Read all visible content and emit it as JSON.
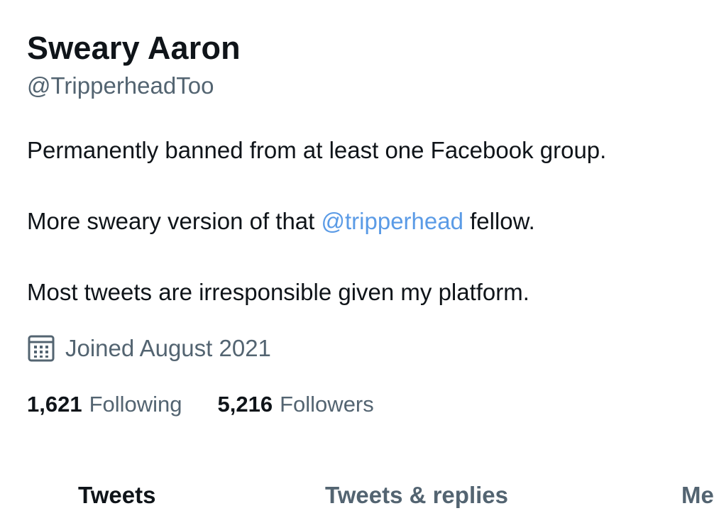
{
  "profile": {
    "display_name": "Sweary Aaron",
    "handle": "@TripperheadToo",
    "bio": {
      "line1": "Permanently banned from at least one Facebook group.",
      "line2_before": "More sweary version of that ",
      "line2_mention": "@tripperhead",
      "line2_after": " fellow.",
      "line3": "Most tweets are irresponsible given my platform."
    },
    "joined": {
      "icon": "calendar-icon",
      "text": "Joined August 2021"
    },
    "stats": {
      "following_count": "1,621",
      "following_label": "Following",
      "followers_count": "5,216",
      "followers_label": "Followers"
    }
  },
  "tabs": [
    {
      "label": "Tweets",
      "active": true
    },
    {
      "label": "Tweets & replies",
      "active": false
    },
    {
      "label": "Me",
      "active": false
    }
  ],
  "colors": {
    "text_primary": "#0f1419",
    "text_secondary": "#536471",
    "mention": "#5b9be6",
    "background": "#ffffff"
  }
}
